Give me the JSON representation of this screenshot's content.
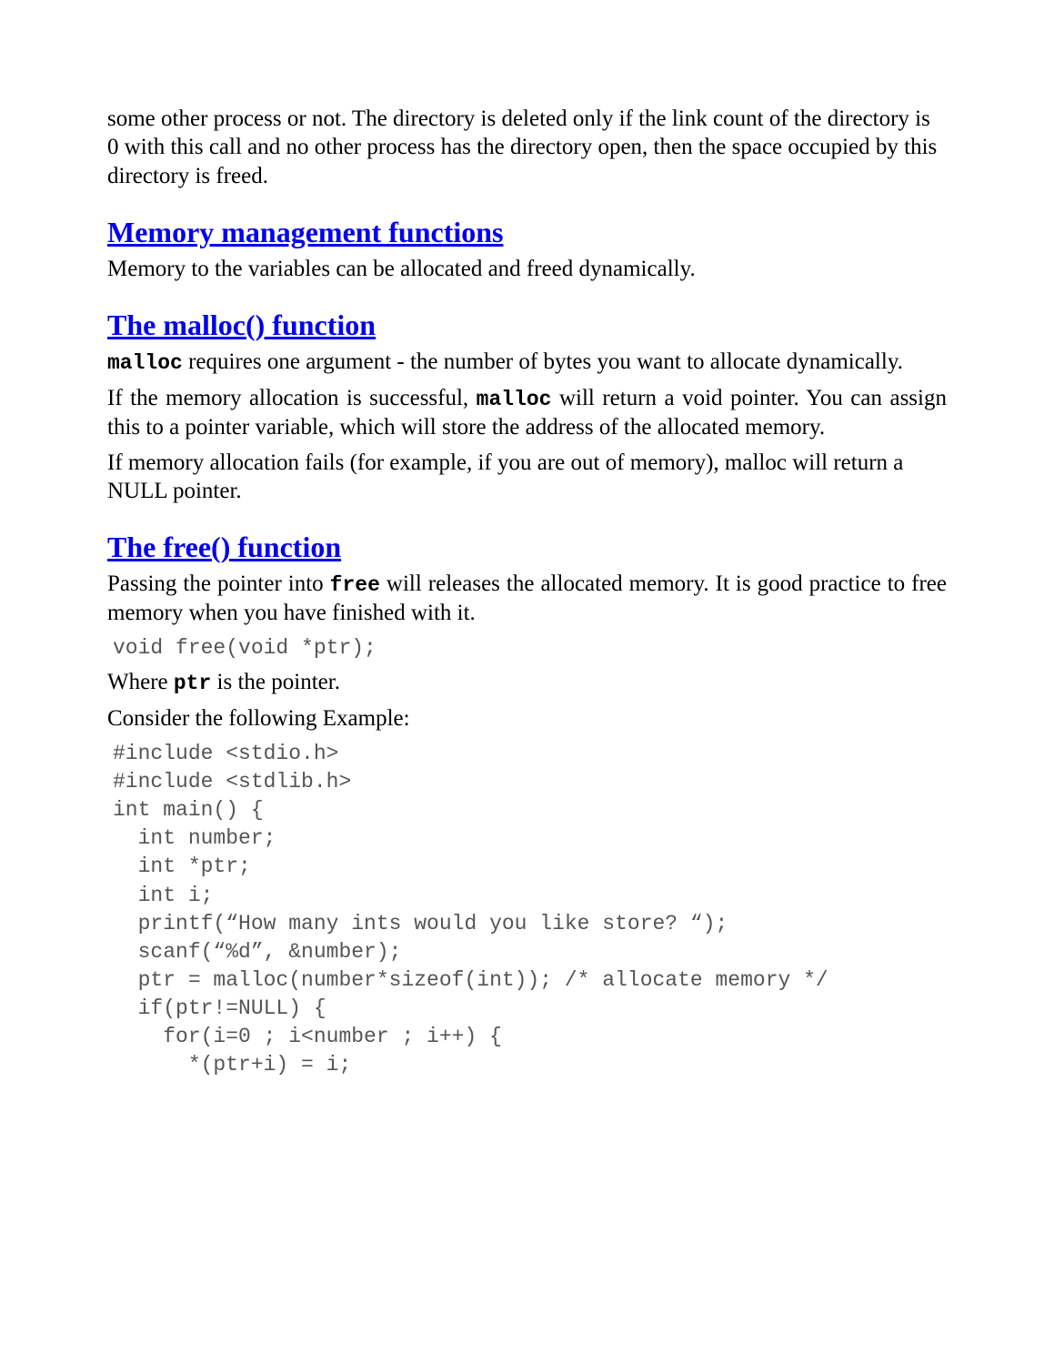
{
  "intro_para": "some other process or not. The directory is deleted only if the link count of the directory is 0 with this call and no other process has the directory open, then the space occupied by this directory is freed.",
  "sections": {
    "memory": {
      "heading": "Memory management functions",
      "para1": "Memory to the variables can be allocated and freed dynamically."
    },
    "malloc": {
      "heading": "The malloc() function",
      "code1": "malloc",
      "para1_tail": " requires one argument - the number of bytes you want to allocate dynamically.",
      "para2_lead": "If the memory allocation is successful, ",
      "code2": "malloc",
      "para2_tail": " will return a void pointer. You can assign this to a pointer variable, which will store the address of the allocated memory.",
      "para3": "If memory allocation fails (for example, if you are out of memory), malloc will return a NULL pointer."
    },
    "free": {
      "heading": "The free() function",
      "para1_lead": "Passing the pointer into ",
      "code1": "free",
      "para1_tail": " will releases the allocated memory. It is good practice to free memory when you have finished with it.",
      "code_sig": "void free(void *ptr);",
      "para2_lead": "Where ",
      "code2": "ptr",
      "para2_tail": " is the pointer.",
      "para3": "Consider the following Example:",
      "example_code": "#include <stdio.h>\n#include <stdlib.h>\nint main() {\n  int number;\n  int *ptr;\n  int i;\n  printf(“How many ints would you like store? “);\n  scanf(“%d”, &number);\n  ptr = malloc(number*sizeof(int)); /* allocate memory */\n  if(ptr!=NULL) {\n    for(i=0 ; i<number ; i++) {\n      *(ptr+i) = i;"
    }
  }
}
